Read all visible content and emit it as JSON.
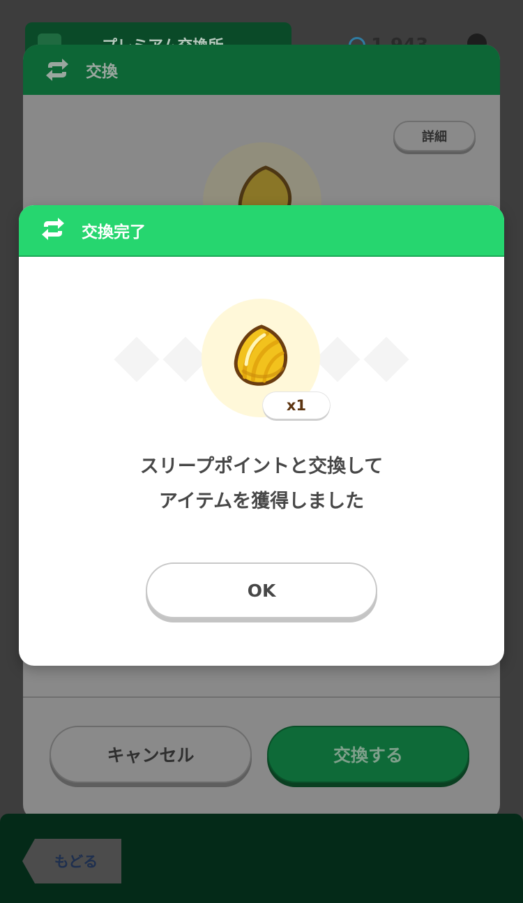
{
  "background": {
    "tab_title": "プレミアム交換所",
    "currency_value": "1,943",
    "modal_title": "交換",
    "detail_label": "詳細",
    "cancel_label": "キャンセル",
    "exchange_label": "交換する",
    "back_label": "もどる"
  },
  "dialog": {
    "title": "交換完了",
    "item_icon": "golden-seed-icon",
    "quantity": "x1",
    "message_line1": "スリープポイントと交換して",
    "message_line2": "アイテムを獲得しました",
    "ok_label": "OK"
  },
  "colors": {
    "dialog_header": "#26d66f",
    "bg_header": "#0d6636",
    "item_glow": "#fff8d9",
    "seed_gold": "#f2c21d",
    "text": "#474747"
  }
}
